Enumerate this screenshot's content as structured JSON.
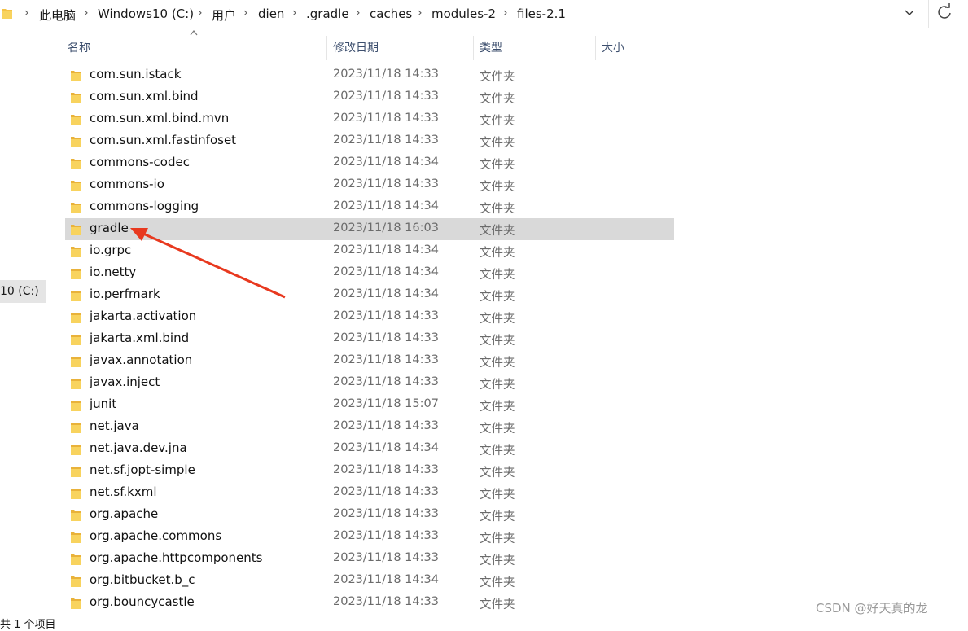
{
  "breadcrumb": {
    "items": [
      "此电脑",
      "Windows10 (C:)",
      "用户",
      "dien",
      ".gradle",
      "caches",
      "modules-2",
      "files-2.1"
    ]
  },
  "toolbar": {
    "dropdown_icon": "chevron-down-icon",
    "refresh_icon": "refresh-icon"
  },
  "nav": {
    "drive_label": "10 (C:)"
  },
  "status": {
    "text": "共 1 个项目"
  },
  "columns": {
    "name": "名称",
    "date": "修改日期",
    "type": "类型",
    "size": "大小"
  },
  "rows": [
    {
      "name": "com.sun.istack",
      "date": "2023/11/18 14:33",
      "type": "文件夹"
    },
    {
      "name": "com.sun.xml.bind",
      "date": "2023/11/18 14:33",
      "type": "文件夹"
    },
    {
      "name": "com.sun.xml.bind.mvn",
      "date": "2023/11/18 14:33",
      "type": "文件夹"
    },
    {
      "name": "com.sun.xml.fastinfoset",
      "date": "2023/11/18 14:33",
      "type": "文件夹"
    },
    {
      "name": "commons-codec",
      "date": "2023/11/18 14:34",
      "type": "文件夹"
    },
    {
      "name": "commons-io",
      "date": "2023/11/18 14:33",
      "type": "文件夹"
    },
    {
      "name": "commons-logging",
      "date": "2023/11/18 14:34",
      "type": "文件夹"
    },
    {
      "name": "gradle",
      "date": "2023/11/18 16:03",
      "type": "文件夹",
      "selected": true
    },
    {
      "name": "io.grpc",
      "date": "2023/11/18 14:34",
      "type": "文件夹"
    },
    {
      "name": "io.netty",
      "date": "2023/11/18 14:34",
      "type": "文件夹"
    },
    {
      "name": "io.perfmark",
      "date": "2023/11/18 14:34",
      "type": "文件夹"
    },
    {
      "name": "jakarta.activation",
      "date": "2023/11/18 14:33",
      "type": "文件夹"
    },
    {
      "name": "jakarta.xml.bind",
      "date": "2023/11/18 14:33",
      "type": "文件夹"
    },
    {
      "name": "javax.annotation",
      "date": "2023/11/18 14:33",
      "type": "文件夹"
    },
    {
      "name": "javax.inject",
      "date": "2023/11/18 14:33",
      "type": "文件夹"
    },
    {
      "name": "junit",
      "date": "2023/11/18 15:07",
      "type": "文件夹"
    },
    {
      "name": "net.java",
      "date": "2023/11/18 14:33",
      "type": "文件夹"
    },
    {
      "name": "net.java.dev.jna",
      "date": "2023/11/18 14:34",
      "type": "文件夹"
    },
    {
      "name": "net.sf.jopt-simple",
      "date": "2023/11/18 14:33",
      "type": "文件夹"
    },
    {
      "name": "net.sf.kxml",
      "date": "2023/11/18 14:33",
      "type": "文件夹"
    },
    {
      "name": "org.apache",
      "date": "2023/11/18 14:33",
      "type": "文件夹"
    },
    {
      "name": "org.apache.commons",
      "date": "2023/11/18 14:33",
      "type": "文件夹"
    },
    {
      "name": "org.apache.httpcomponents",
      "date": "2023/11/18 14:33",
      "type": "文件夹"
    },
    {
      "name": "org.bitbucket.b_c",
      "date": "2023/11/18 14:34",
      "type": "文件夹"
    },
    {
      "name": "org.bouncycastle",
      "date": "2023/11/18 14:33",
      "type": "文件夹"
    }
  ],
  "colors": {
    "selection": "#d9d9d9",
    "folder": "#f5c245",
    "annotation_arrow": "#e8391f"
  },
  "watermark": "CSDN @好天真的龙"
}
